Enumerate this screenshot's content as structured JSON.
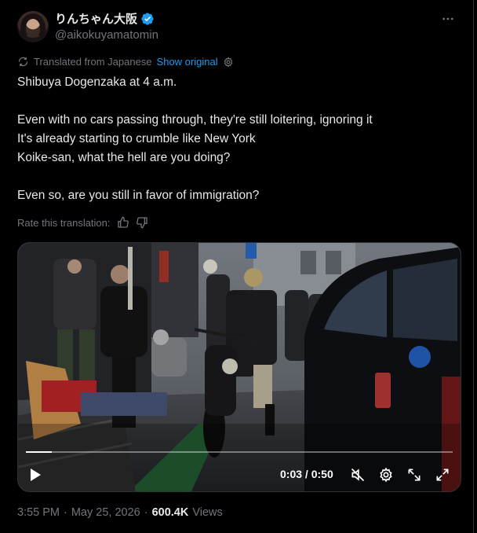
{
  "author": {
    "display_name": "りんちゃん大阪",
    "handle": "@aikokuyamatomin",
    "verified": true,
    "verified_color": "#1d9bf0"
  },
  "translation": {
    "label": "Translated from Japanese",
    "show_original": "Show original",
    "rate_label": "Rate this translation:"
  },
  "tweet": {
    "lines": [
      "Shibuya Dogenzaka at 4 a.m.",
      "",
      "Even with no cars passing through, they're still loitering, ignoring it",
      "It's already starting to crumble like New York",
      "Koike-san, what the hell are you doing?",
      "",
      "Even so, are you still in favor of immigration?"
    ]
  },
  "video": {
    "current_time": "0:03",
    "duration": "0:50",
    "time_separator": " / ",
    "progress": 0.06
  },
  "meta": {
    "time": "3:55 PM",
    "separator": "·",
    "date": "May 25, 2026",
    "views_count": "600.4K",
    "views_label": "Views"
  },
  "icons": {
    "more": "more-horizontal-icon",
    "translate": "translate-icon",
    "settings": "gear-icon",
    "thumbs_up": "thumbs-up-icon",
    "thumbs_down": "thumbs-down-icon",
    "play": "play-icon",
    "mute": "muted-speaker-icon",
    "video_settings": "gear-icon",
    "pop_out": "pop-out-icon",
    "fullscreen": "fullscreen-icon"
  },
  "colors": {
    "background": "#000000",
    "text": "#e7e9ea",
    "secondary": "#71767b",
    "link": "#1d9bf0"
  }
}
